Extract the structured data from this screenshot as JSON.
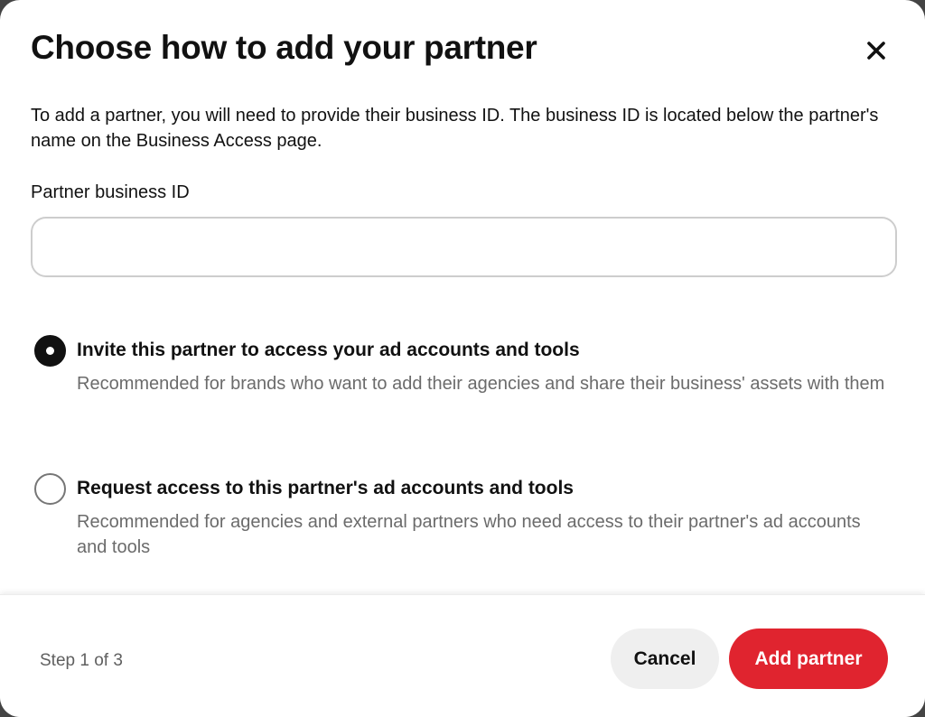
{
  "dialog": {
    "title": "Choose how to add your partner",
    "intro": "To add a partner, you will need to provide their business ID. The business ID is located below the partner's name on the Business Access page.",
    "close_icon": "close-icon"
  },
  "form": {
    "field_label": "Partner business ID",
    "field_value": "",
    "field_placeholder": ""
  },
  "options": [
    {
      "title": "Invite this partner to access your ad accounts and tools",
      "description": "Recommended for brands who want to add their agencies and share their business' assets with them",
      "selected": true
    },
    {
      "title": "Request access to this partner's ad accounts and tools",
      "description": "Recommended for agencies and external partners who need access to their partner's ad accounts and tools",
      "selected": false
    }
  ],
  "footer": {
    "step": "Step 1 of 3",
    "cancel_label": "Cancel",
    "add_label": "Add partner"
  },
  "colors": {
    "primary_button": "#e0242f",
    "secondary_button": "#efefef",
    "text": "#111111",
    "muted_text": "#6b6b6b"
  }
}
